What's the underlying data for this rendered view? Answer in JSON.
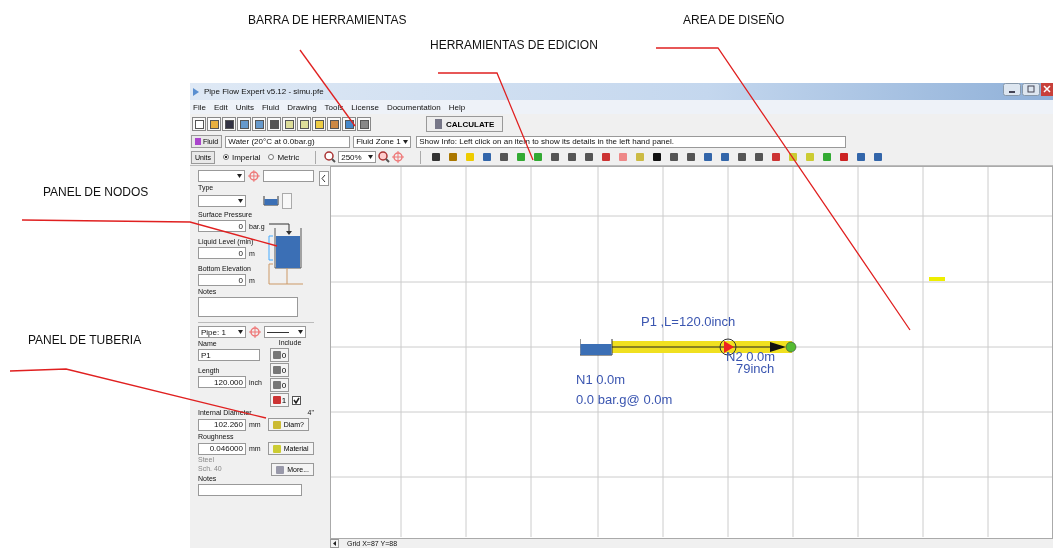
{
  "annotations": [
    {
      "text": "BARRA DE HERRAMIENTAS"
    },
    {
      "text": "HERRAMIENTAS DE EDICION"
    },
    {
      "text": "AREA DE DISEÑO"
    },
    {
      "text": "PANEL DE NODOS"
    },
    {
      "text": "PANEL DE TUBERIA"
    }
  ],
  "window": {
    "title": "Pipe Flow Expert v5.12 - simu.pfe"
  },
  "menu": [
    "File",
    "Edit",
    "Units",
    "Fluid",
    "Drawing",
    "Tools",
    "License",
    "Documentation",
    "Help"
  ],
  "calculate_button": "CALCULATE",
  "fluid": {
    "button": "Fluid",
    "value": "Water (20°C at 0.0bar.g)",
    "zone": "Fluid Zone 1"
  },
  "show_info": "Show Info: Left click on an item to show its details in the left hand panel.",
  "units": {
    "button": "Units",
    "options": [
      {
        "label": "Imperial",
        "selected": true
      },
      {
        "label": "Metric",
        "selected": false
      }
    ]
  },
  "zoom": "250%",
  "node_panel": {
    "type_label": "Type",
    "surface_pressure": {
      "label": "Surface Pressure",
      "value": "0",
      "unit": "bar.g"
    },
    "liquid_level": {
      "label": "Liquid Level (min)",
      "value": "0",
      "unit": "m"
    },
    "bottom_elevation": {
      "label": "Bottom Elevation",
      "value": "0",
      "unit": "m"
    },
    "notes_label": "Notes"
  },
  "pipe_panel": {
    "pipe_select": "Pipe:  1",
    "name": {
      "label": "Name",
      "value": "P1"
    },
    "include_label": "Include",
    "counts": [
      {
        "value": "0"
      },
      {
        "value": "0"
      },
      {
        "value": "0"
      },
      {
        "value": "1",
        "checked": true
      }
    ],
    "length": {
      "label": "Length",
      "value": "120.000",
      "unit": "inch"
    },
    "internal_diameter": {
      "label": "Internal Diameter",
      "value": "102.260",
      "unit": "mm",
      "hint": "4\""
    },
    "diam_button": "Diam?",
    "roughness": {
      "label": "Roughness",
      "value": "0.046000",
      "unit": "mm"
    },
    "material_button": "Material",
    "material": [
      "Steel",
      "Sch. 40"
    ],
    "more_button": "More...",
    "notes_label": "Notes"
  },
  "canvas": {
    "pipe_label": "P1 ,L=120.0inch",
    "node1": [
      "N1  0.0m",
      "0.0 bar.g@ 0.0m"
    ],
    "node2": "N2 0.0m",
    "pump_label": "79inch"
  },
  "status_bar": "Grid X=87 Y=88"
}
